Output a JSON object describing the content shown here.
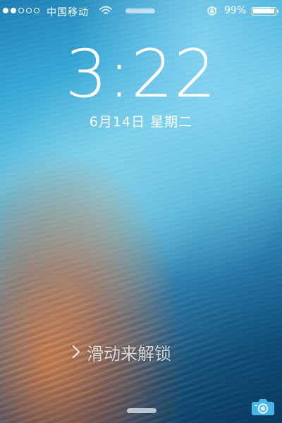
{
  "status_bar": {
    "signal_strength": 2,
    "carrier": "中国移动",
    "battery_percent_text": "99%",
    "battery_level": 0.99,
    "icons": [
      "signal-dots-icon",
      "wifi-icon",
      "rotation-lock-icon",
      "battery-icon"
    ]
  },
  "lock_screen": {
    "time": "3:22",
    "date": "6月14日 星期二",
    "unlock_prompt": "滑动来解锁",
    "icons": [
      "chevron-right-icon",
      "camera-icon"
    ]
  },
  "colors": {
    "text": "#ffffff",
    "wallpaper_blue": "#38a8d6",
    "wallpaper_deep_blue": "#0f4d78",
    "wallpaper_orange": "#c75a2e"
  }
}
